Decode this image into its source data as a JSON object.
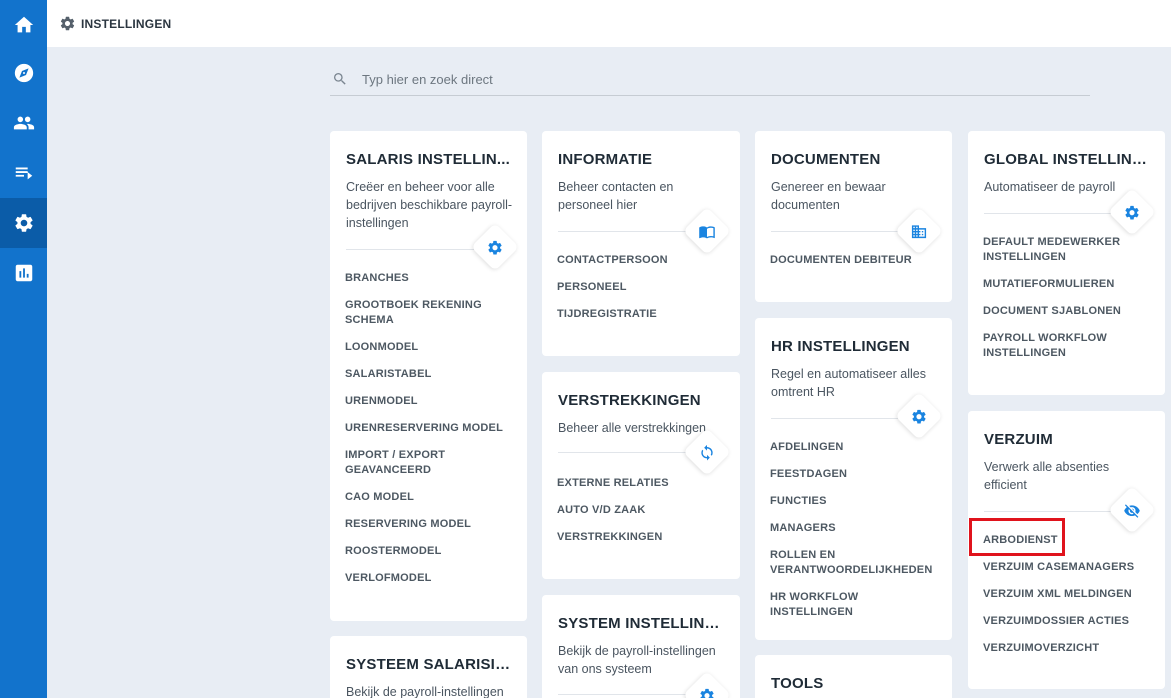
{
  "topbar": {
    "title": "INSTELLINGEN",
    "icon": "gear-icon"
  },
  "sidebar": {
    "items": [
      {
        "name": "home",
        "icon": "home-icon"
      },
      {
        "name": "explore",
        "icon": "compass-icon"
      },
      {
        "name": "people",
        "icon": "people-icon"
      },
      {
        "name": "list",
        "icon": "playlist-icon"
      },
      {
        "name": "settings",
        "icon": "gear-icon",
        "active": true
      },
      {
        "name": "reports",
        "icon": "bar-chart-icon"
      }
    ]
  },
  "search": {
    "placeholder": "Typ hier en zoek direct",
    "value": ""
  },
  "cards": {
    "salaris": {
      "title": "SALARIS INSTELLIN...",
      "desc": "Creëer en beheer voor alle bedrijven beschikbare payroll-instellingen",
      "icon": "gear-icon",
      "items": [
        "BRANCHES",
        "GROOTBOEK REKENING SCHEMA",
        "LOONMODEL",
        "SALARISTABEL",
        "URENMODEL",
        "URENRESERVERING MODEL",
        "IMPORT / EXPORT GEAVANCEERD",
        "CAO MODEL",
        "RESERVERING MODEL",
        "ROOSTERMODEL",
        "VERLOFMODEL"
      ]
    },
    "systeemSalaris": {
      "title": "SYSTEEM SALARISIN...",
      "desc": "Bekijk de payroll-instellingen"
    },
    "informatie": {
      "title": "INFORMATIE",
      "desc": "Beheer contacten en personeel hier",
      "icon": "book-icon",
      "items": [
        "CONTACTPERSOON",
        "PERSONEEL",
        "TIJDREGISTRATIE"
      ]
    },
    "verstrekkingen": {
      "title": "VERSTREKKINGEN",
      "desc": "Beheer alle verstrekkingen",
      "icon": "sync-icon",
      "items": [
        "EXTERNE RELATIES",
        "AUTO V/D ZAAK",
        "VERSTREKKINGEN"
      ]
    },
    "systemInstelling": {
      "title": "SYSTEM INSTELLING...",
      "desc": "Bekijk de payroll-instellingen van ons systeem",
      "icon": "gear-icon"
    },
    "documenten": {
      "title": "DOCUMENTEN",
      "desc": "Genereer en bewaar documenten",
      "icon": "building-icon",
      "items": [
        "DOCUMENTEN DEBITEUR"
      ]
    },
    "hr": {
      "title": "HR INSTELLINGEN",
      "desc": "Regel en automatiseer alles omtrent HR",
      "icon": "gear-icon",
      "items": [
        "AFDELINGEN",
        "FEESTDAGEN",
        "FUNCTIES",
        "MANAGERS",
        "ROLLEN EN VERANTWOORDELIJKHEDEN",
        "HR WORKFLOW INSTELLINGEN"
      ]
    },
    "tools": {
      "title": "TOOLS"
    },
    "global": {
      "title": "GLOBAL INSTELLING...",
      "desc": "Automatiseer de payroll",
      "icon": "gear-icon",
      "items": [
        "DEFAULT MEDEWERKER INSTELLINGEN",
        "MUTATIEFORMULIEREN",
        "DOCUMENT SJABLONEN",
        "PAYROLL WORKFLOW INSTELLINGEN"
      ]
    },
    "verzuim": {
      "title": "VERZUIM",
      "desc": "Verwerk alle absenties efficient",
      "icon": "eye-off-icon",
      "items": [
        "ARBODIENST",
        "VERZUIM CASEMANAGERS",
        "VERZUIM XML MELDINGEN",
        "VERZUIMDOSSIER ACTIES",
        "VERZUIMOVERZICHT"
      ]
    }
  },
  "colors": {
    "sidebar": "#1273cc",
    "accent": "#1a84e0",
    "highlight": "#e0131c",
    "background": "#e8edf4"
  }
}
